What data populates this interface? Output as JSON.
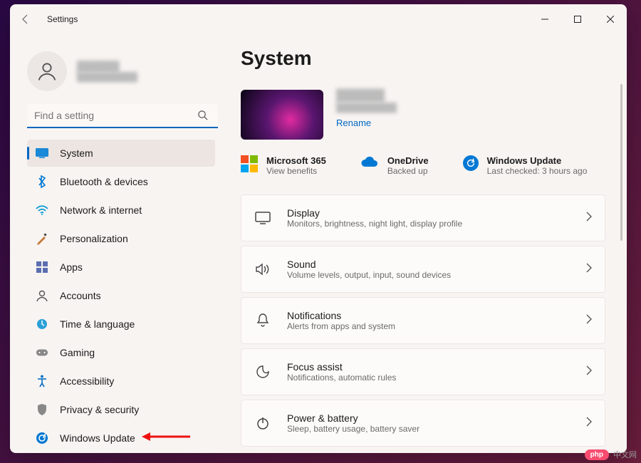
{
  "app_title": "Settings",
  "profile": {
    "name": "██████",
    "email": "██████████"
  },
  "search": {
    "placeholder": "Find a setting"
  },
  "nav": [
    {
      "icon": "system-icon",
      "label": "System",
      "selected": true
    },
    {
      "icon": "bluetooth-icon",
      "label": "Bluetooth & devices"
    },
    {
      "icon": "network-icon",
      "label": "Network & internet"
    },
    {
      "icon": "personalization-icon",
      "label": "Personalization"
    },
    {
      "icon": "apps-icon",
      "label": "Apps"
    },
    {
      "icon": "accounts-icon",
      "label": "Accounts"
    },
    {
      "icon": "time-icon",
      "label": "Time & language"
    },
    {
      "icon": "gaming-icon",
      "label": "Gaming"
    },
    {
      "icon": "accessibility-icon",
      "label": "Accessibility"
    },
    {
      "icon": "privacy-icon",
      "label": "Privacy & security"
    },
    {
      "icon": "update-icon",
      "label": "Windows Update"
    }
  ],
  "page_title": "System",
  "device": {
    "name": "██████",
    "model": "██████████",
    "rename": "Rename"
  },
  "promos": [
    {
      "title": "Microsoft 365",
      "sub": "View benefits"
    },
    {
      "title": "OneDrive",
      "sub": "Backed up"
    },
    {
      "title": "Windows Update",
      "sub": "Last checked: 3 hours ago"
    }
  ],
  "cards": [
    {
      "icon": "display-icon",
      "title": "Display",
      "sub": "Monitors, brightness, night light, display profile"
    },
    {
      "icon": "sound-icon",
      "title": "Sound",
      "sub": "Volume levels, output, input, sound devices"
    },
    {
      "icon": "notifications-icon",
      "title": "Notifications",
      "sub": "Alerts from apps and system"
    },
    {
      "icon": "focus-icon",
      "title": "Focus assist",
      "sub": "Notifications, automatic rules"
    },
    {
      "icon": "power-icon",
      "title": "Power & battery",
      "sub": "Sleep, battery usage, battery saver"
    }
  ],
  "watermark": "中文网"
}
